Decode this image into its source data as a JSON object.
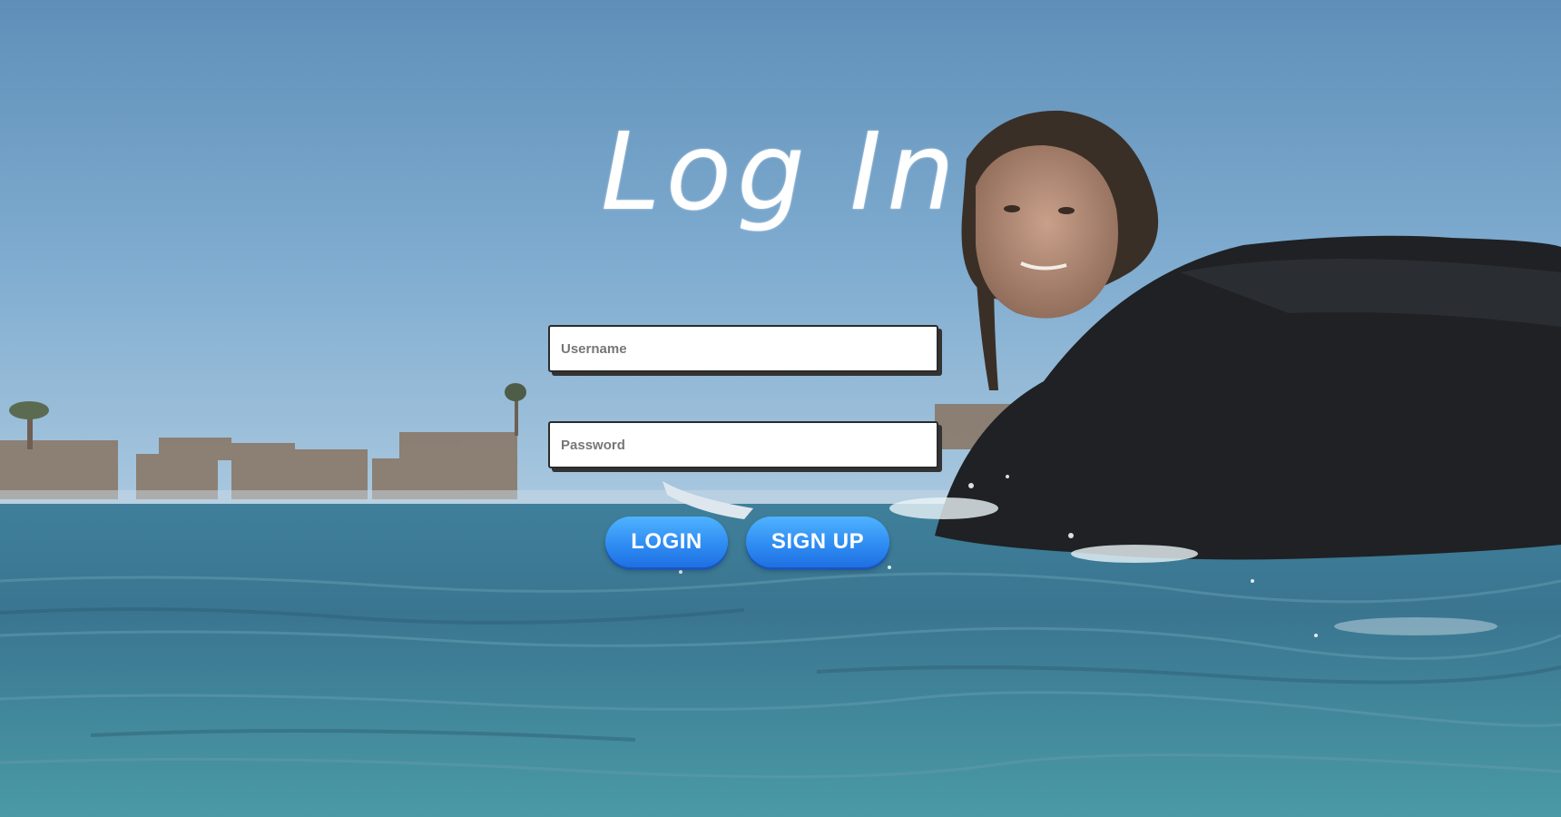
{
  "page": {
    "title": "Log In"
  },
  "form": {
    "username": {
      "placeholder": "Username",
      "value": ""
    },
    "password": {
      "placeholder": "Password",
      "value": ""
    }
  },
  "buttons": {
    "login_label": "LOGIN",
    "signup_label": "SIGN UP"
  },
  "colors": {
    "button_accent": "#2f8df2",
    "title_text": "#ffffff",
    "field_border": "#2b2b2b"
  },
  "background": {
    "description_icon": "surfer-ocean-photo"
  }
}
